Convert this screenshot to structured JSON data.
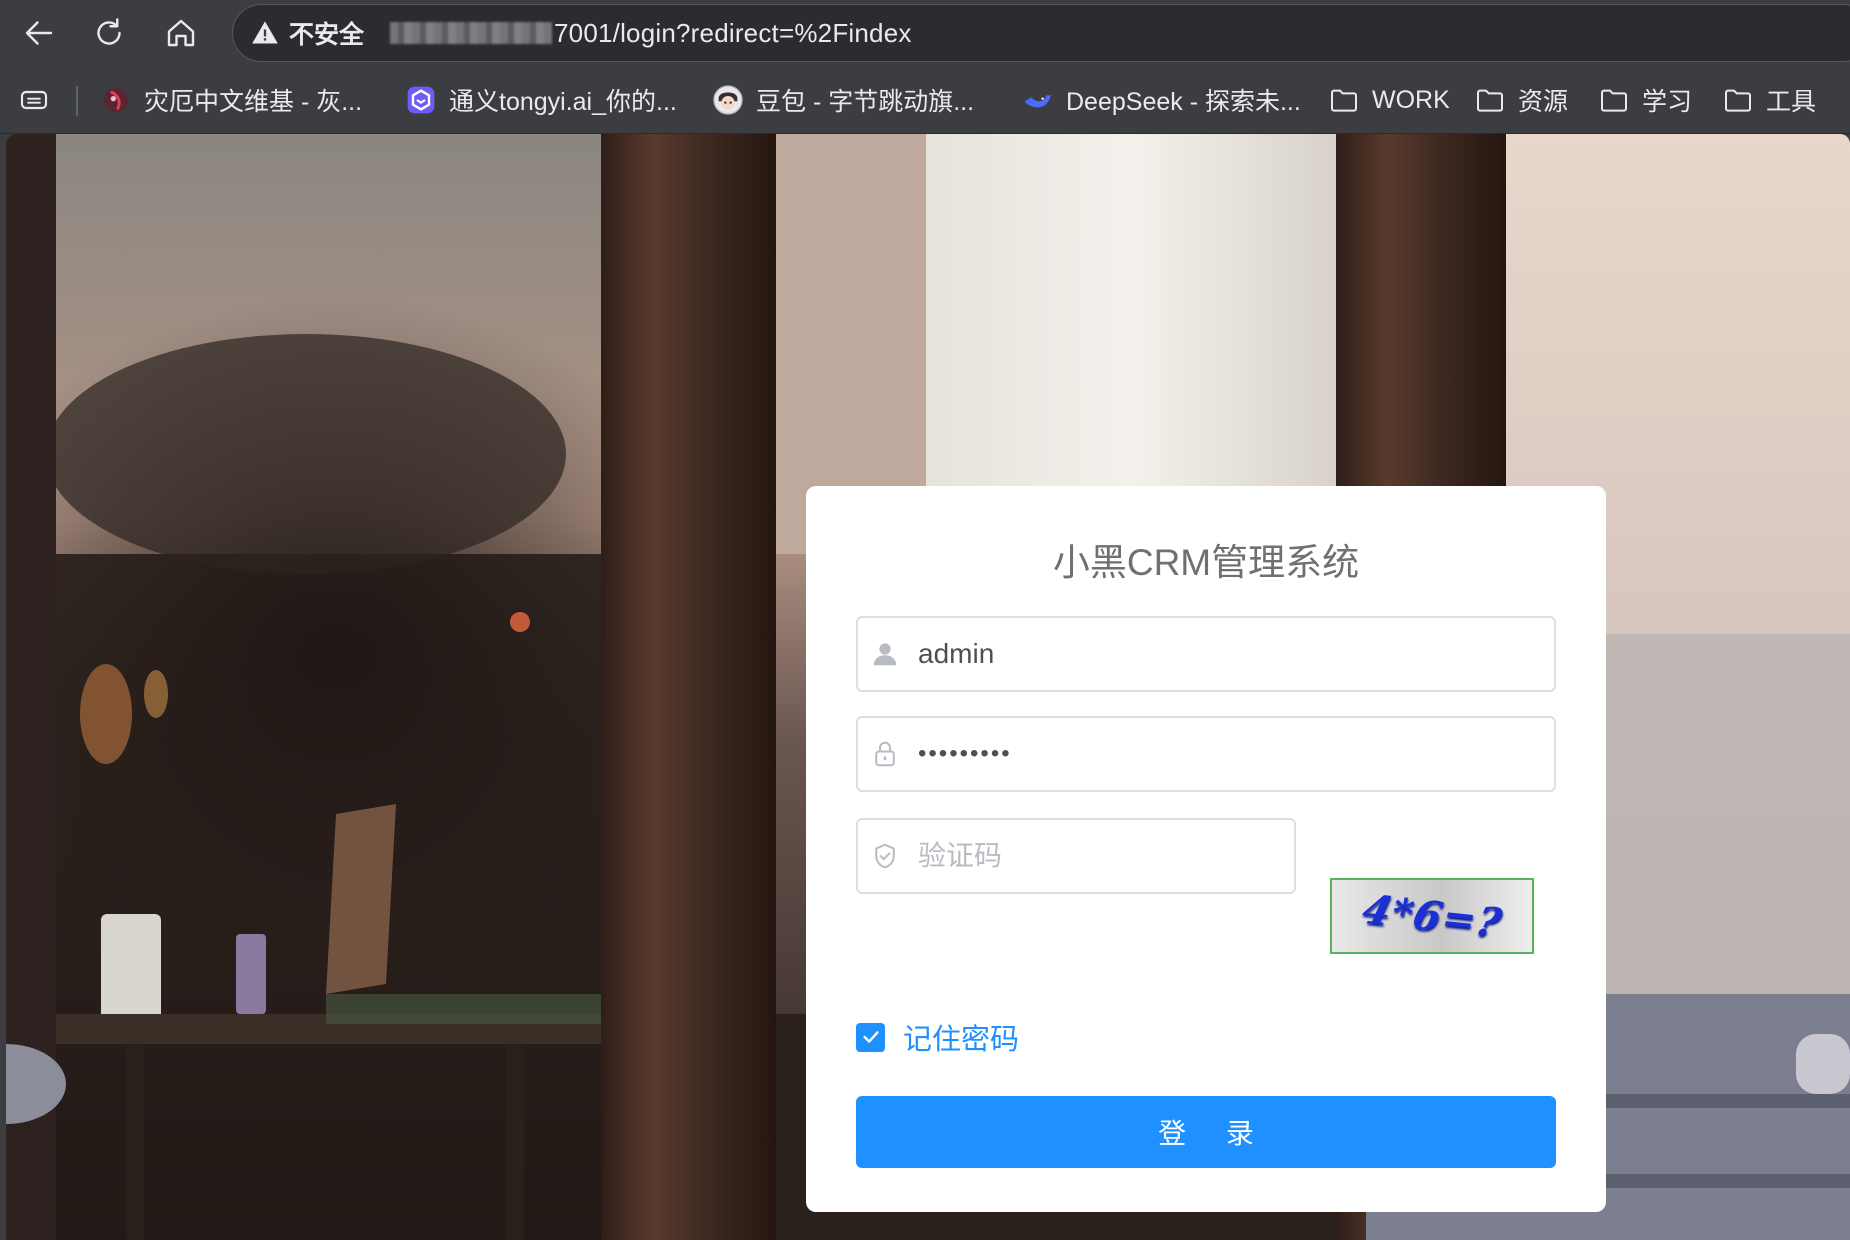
{
  "browser": {
    "security_label": "不安全",
    "url_visible": "7001/login?redirect=%2Findex",
    "nav": {
      "back_icon": "arrow-left-icon",
      "reload_icon": "reload-icon",
      "home_icon": "home-icon"
    }
  },
  "bookmarks": [
    {
      "label": "灾厄中文维基 - 灰...",
      "icon": "wiki-logo-icon"
    },
    {
      "label": "通义tongyi.ai_你的...",
      "icon": "tongyi-logo-icon"
    },
    {
      "label": "豆包 - 字节跳动旗...",
      "icon": "doubao-avatar-icon"
    },
    {
      "label": "DeepSeek - 探索未...",
      "icon": "deepseek-whale-icon"
    },
    {
      "label": "WORK",
      "icon": "folder-icon"
    },
    {
      "label": "资源",
      "icon": "folder-icon"
    },
    {
      "label": "学习",
      "icon": "folder-icon"
    },
    {
      "label": "工具",
      "icon": "folder-icon"
    }
  ],
  "login": {
    "title": "小黑CRM管理系统",
    "username_value": "admin",
    "password_value": "•••••••••",
    "captcha_placeholder": "验证码",
    "captcha_text": "4*6=?",
    "remember_label": "记住密码",
    "remember_checked": true,
    "submit_label": "登 录",
    "accent_color": "#1e90ff"
  }
}
